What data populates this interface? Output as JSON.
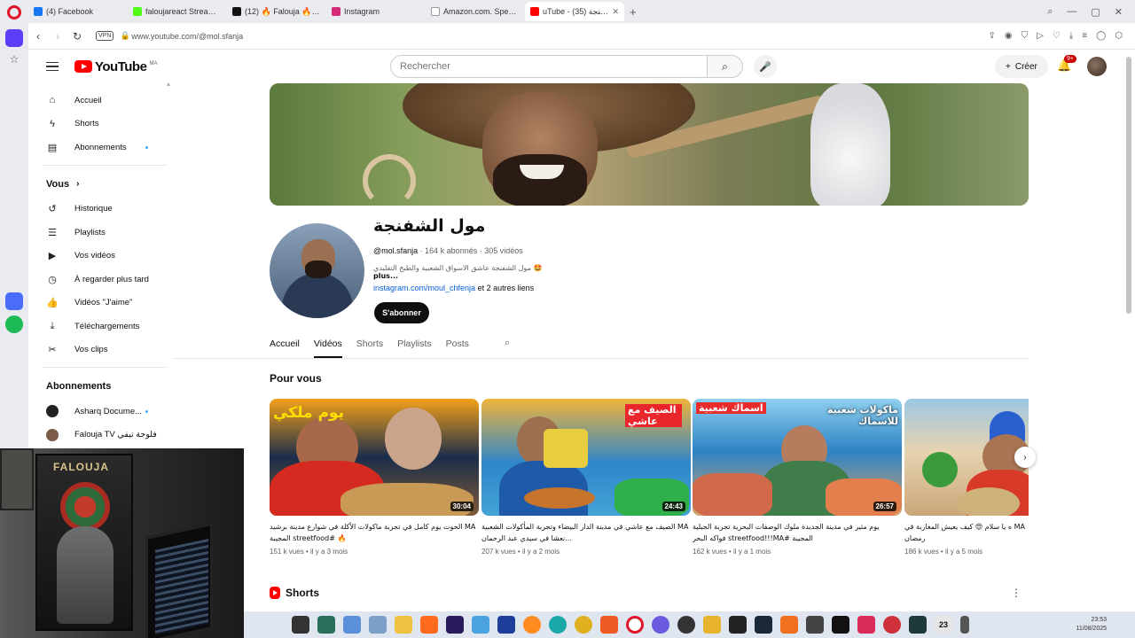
{
  "browser": {
    "tabs": [
      {
        "label": "(4) Facebook",
        "color": "#1877f2"
      },
      {
        "label": "faloujareact Stream - Watch",
        "color": "#53fc18"
      },
      {
        "label": "(12) 🔥 Falouja 🔥 (@falo",
        "color": "#111111"
      },
      {
        "label": "Instagram",
        "color": "#d62976"
      },
      {
        "label": "Amazon.com. Spend less.",
        "color": "#ffffff"
      },
      {
        "label": "uTube - مول الشفنجة (35)",
        "color": "#ff0000",
        "active": true
      }
    ],
    "new_tab": "+",
    "vpn": "VPN",
    "url": "www.youtube.com/@mol.sfanja"
  },
  "yt": {
    "logo": "YouTube",
    "country": "MA",
    "search_placeholder": "Rechercher",
    "create": "Créer",
    "notif_count": "9+"
  },
  "nav": {
    "main": [
      {
        "label": "Accueil",
        "icon": "⌂"
      },
      {
        "label": "Shorts",
        "icon": "ϟ"
      },
      {
        "label": "Abonnements",
        "icon": "▤",
        "dot": true
      }
    ],
    "you_title": "Vous",
    "you": [
      {
        "label": "Historique",
        "icon": "↺"
      },
      {
        "label": "Playlists",
        "icon": "☰"
      },
      {
        "label": "Vos vidéos",
        "icon": "▶"
      },
      {
        "label": "À regarder plus tard",
        "icon": "◷"
      },
      {
        "label": "Vidéos \"J'aime\"",
        "icon": "👍"
      },
      {
        "label": "Téléchargements",
        "icon": "⤓"
      },
      {
        "label": "Vos clips",
        "icon": "✂"
      }
    ],
    "subs_title": "Abonnements",
    "subs": [
      {
        "label": "Asharq Docume...",
        "dot": true
      },
      {
        "label": "Falouja TV فلوجة تيفي"
      }
    ]
  },
  "webcam": {
    "poster_text": "FALOUJA"
  },
  "channel": {
    "name": "مول الشفنجة",
    "handle": "@mol.sfanja",
    "subscribers": "164 k abonnés",
    "videos": "305 vidéos",
    "description": "🤩 مول الشفنجة عاشق الاسواق الشعبية والطبخ التقليدي",
    "more": "...plus",
    "link": "instagram.com/moul_chfenja",
    "other_links": "et 2 autres liens",
    "subscribe": "S'abonner",
    "tabs": [
      "Accueil",
      "Vidéos",
      "Shorts",
      "Playlists",
      "Posts"
    ]
  },
  "section_title": "Pour vous",
  "videos": [
    {
      "duration": "30:04",
      "title": "MA الحوت يوم كامل في تجربة ماكولات الأكلة في شوارع مدينة برشيد 🔥 #streetfood المجيبة",
      "meta": "151 k vues • il y a 3 mois"
    },
    {
      "duration": "24:43",
      "title": "MA الصيف مع عاشي في مدينة الدار البيضاء وتجربة المأكولات الشعبية ...نعشا في سيدي عبد الرحمان",
      "meta": "207 k vues • il y a 2 mois"
    },
    {
      "duration": "26:57",
      "title": "يوم مثير في مدينة الجديدة ملوك الوصفات البحرية تجربة الجبلية المجيبة #streetfood!!!MA فواكه البحر",
      "meta": "162 k vues • il y a 1 mois"
    },
    {
      "duration": "",
      "title": "MA ه يا سلام 😍 كيف يعيش المغاربة في رمضان",
      "meta": "186 k vues • il y a 5 mois"
    }
  ],
  "thumb_texts": [
    "يوم ملكي",
    "الصيف مع عاشي",
    "اسماك شعبية",
    "ماكولات شعبية للاسماك"
  ],
  "shorts_title": "Shorts",
  "taskbar": {
    "time": "23:53",
    "date": "11/08/2025",
    "badge": "23"
  }
}
